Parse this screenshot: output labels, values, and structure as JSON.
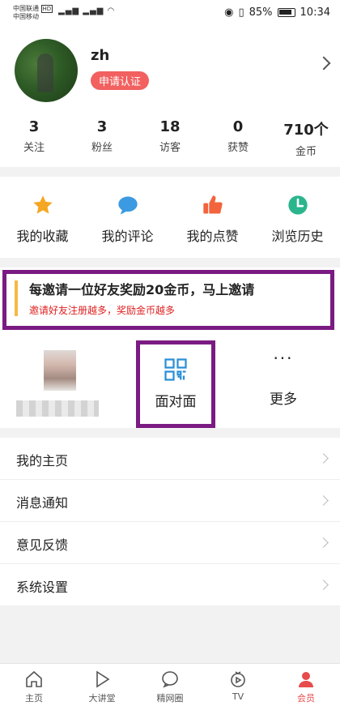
{
  "status_bar": {
    "carrier_1": "中国联通",
    "carrier_1_tag": "HD",
    "carrier_2": "中国移动",
    "battery": "85%",
    "time": "10:34"
  },
  "profile": {
    "username": "zh",
    "certify_label": "申请认证",
    "stats": [
      {
        "value": "3",
        "label": "关注"
      },
      {
        "value": "3",
        "label": "粉丝"
      },
      {
        "value": "18",
        "label": "访客"
      },
      {
        "value": "0",
        "label": "获赞"
      },
      {
        "value": "710个",
        "label": "金币"
      }
    ]
  },
  "quick_actions": [
    {
      "label": "我的收藏",
      "icon": "star-icon"
    },
    {
      "label": "我的评论",
      "icon": "comment-icon"
    },
    {
      "label": "我的点赞",
      "icon": "thumbs-up-icon"
    },
    {
      "label": "浏览历史",
      "icon": "clock-icon"
    }
  ],
  "invite": {
    "title": "每邀请一位好友奖励20金币，马上邀请",
    "subtitle": "邀请好友注册越多，奖励金币越多"
  },
  "share": {
    "face_to_face_label": "面对面",
    "more_label": "更多",
    "more_icon": "ellipsis-icon"
  },
  "menu": [
    {
      "label": "我的主页"
    },
    {
      "label": "消息通知"
    },
    {
      "label": "意见反馈"
    },
    {
      "label": "系统设置"
    }
  ],
  "tabbar": [
    {
      "label": "主页",
      "icon": "home-icon"
    },
    {
      "label": "大讲堂",
      "icon": "play-icon"
    },
    {
      "label": "精网圈",
      "icon": "chat-bubble-icon"
    },
    {
      "label": "TV",
      "icon": "tv-icon"
    },
    {
      "label": "会员",
      "icon": "user-icon",
      "active": true
    }
  ],
  "colors": {
    "accent_red": "#e74c4c",
    "invite_bar": "#f6b845",
    "annotation_frame": "#7a1a82"
  }
}
